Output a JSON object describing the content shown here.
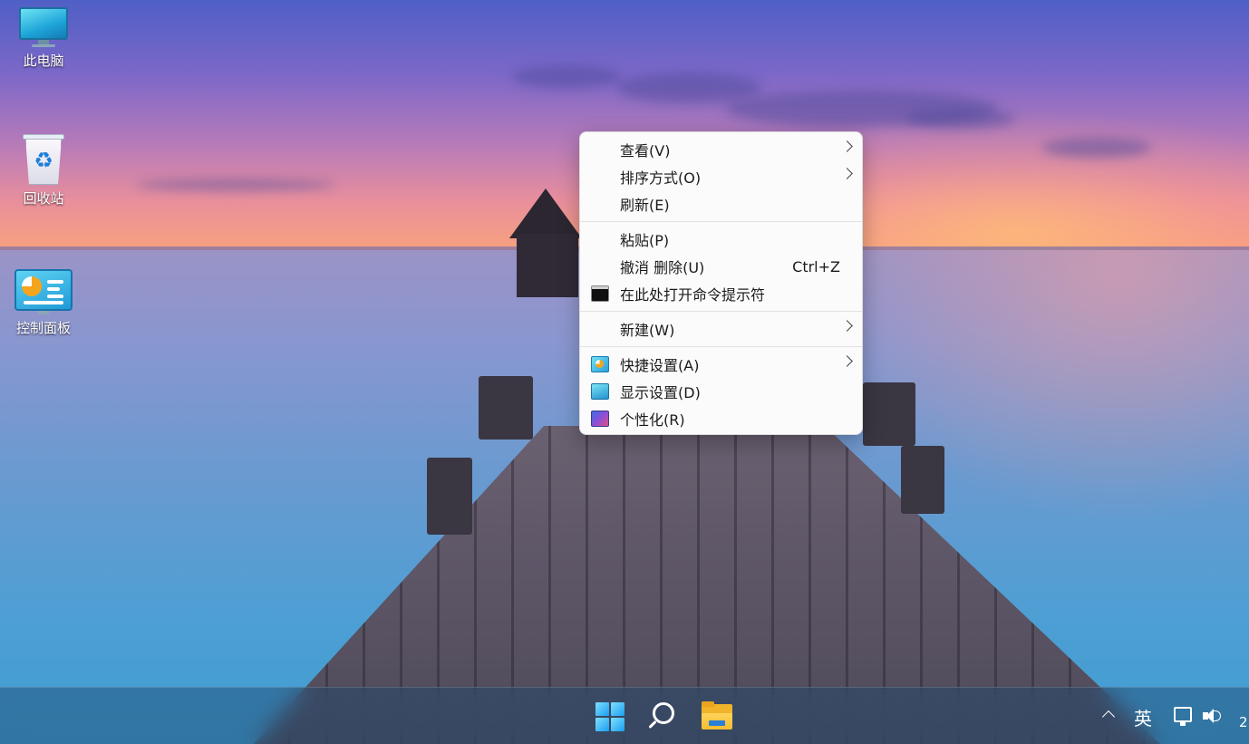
{
  "desktop": {
    "icons": [
      {
        "label": "此电脑",
        "icon": "monitor-icon"
      },
      {
        "label": "回收站",
        "icon": "recycle-bin-icon"
      },
      {
        "label": "控制面板",
        "icon": "control-panel-icon"
      }
    ]
  },
  "context_menu": {
    "items": [
      {
        "label": "查看(V)",
        "has_submenu": true
      },
      {
        "label": "排序方式(O)",
        "has_submenu": true
      },
      {
        "label": "刷新(E)"
      },
      {
        "label": "粘贴(P)"
      },
      {
        "label": "撤消 删除(U)",
        "shortcut": "Ctrl+Z"
      },
      {
        "label": "在此处打开命令提示符",
        "icon": "cmd-icon"
      },
      {
        "label": "新建(W)",
        "has_submenu": true
      },
      {
        "label": "快捷设置(A)",
        "icon": "quick-settings-icon",
        "has_submenu": true
      },
      {
        "label": "显示设置(D)",
        "icon": "display-icon"
      },
      {
        "label": "个性化(R)",
        "icon": "personalize-icon"
      }
    ]
  },
  "taskbar": {
    "pinned": [
      "start-icon",
      "search-icon",
      "file-explorer-icon"
    ],
    "tray": {
      "input_method": "英",
      "clock_partial": "2"
    }
  }
}
